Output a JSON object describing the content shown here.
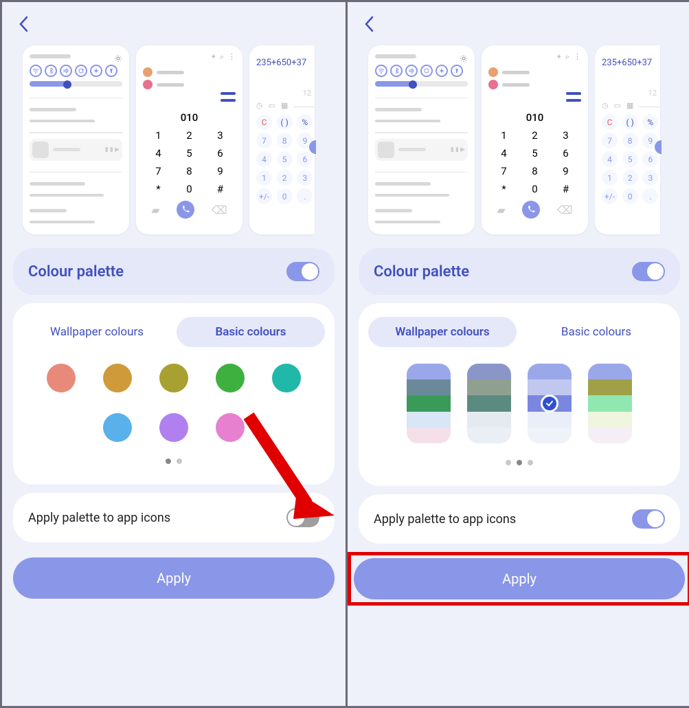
{
  "screen1": {
    "palette_title": "Colour palette",
    "tab_wallpaper": "Wallpaper colours",
    "tab_basic": "Basic colours",
    "apply_palette_label": "Apply palette to app icons",
    "apply_button": "Apply",
    "palette_toggle_on": true,
    "app_icons_toggle_on": false,
    "active_tab": "basic",
    "basic_colors": [
      "#e88a7a",
      "#cf9a3a",
      "#a8a030",
      "#3eb040",
      "#20b8a8",
      "#5ab0ea",
      "#b080ef",
      "#e880d0"
    ],
    "pager_active": 0,
    "pager_total": 2
  },
  "screen2": {
    "palette_title": "Colour palette",
    "tab_wallpaper": "Wallpaper colours",
    "tab_basic": "Basic colours",
    "apply_palette_label": "Apply palette to app icons",
    "apply_button": "Apply",
    "palette_toggle_on": true,
    "app_icons_toggle_on": true,
    "active_tab": "wallpaper",
    "pager_active": 1,
    "pager_total": 3,
    "selected_swatch": 2,
    "wallpaper_swatches": [
      [
        "#9aa8ea",
        "#6a8a9a",
        "#3a9a5a",
        "#d8e6f5",
        "#f5e0ea"
      ],
      [
        "#8a96c8",
        "#90a090",
        "#5a8a80",
        "#e5eaf0",
        "#eaeef5"
      ],
      [
        "#9aa8ea",
        "#c0c8f0",
        "#7a86e0",
        "#eaeef8",
        "#f0f2fa"
      ],
      [
        "#9aa8ea",
        "#a0a048",
        "#90e8b0",
        "#f0f5e0",
        "#f5eef5"
      ]
    ]
  },
  "preview": {
    "dialer": {
      "display": "010",
      "keys": [
        "1",
        "2",
        "3",
        "4",
        "5",
        "6",
        "7",
        "8",
        "9",
        "*",
        "0",
        "#"
      ]
    },
    "calc": {
      "expression": "235+650+37",
      "result_hint": "12",
      "functions_row1": [
        "C",
        "( )",
        "%"
      ],
      "functions_row2": [
        "7",
        "8",
        "9"
      ],
      "functions_row3": [
        "4",
        "5",
        "6"
      ],
      "functions_row4": [
        "1",
        "2",
        "3"
      ],
      "functions_row5": [
        "+/-",
        "0",
        "."
      ]
    }
  }
}
